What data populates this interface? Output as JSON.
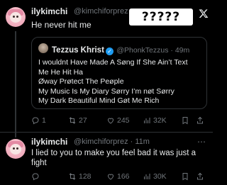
{
  "tweet1": {
    "name": "ilykimchi",
    "handle": "@kimchiforprez ·",
    "text": "He never hit me",
    "quote": {
      "name": "Tezzus Khrist",
      "handle": "@PhonkTezzus · 49m",
      "lines": [
        "I wouldnt Have Made A Søng If She Ain’t Text",
        "Me He Hit Ha",
        "Øway Prøtect The Peøple",
        "My Music Is My Diary Sørry I’m nøt Sørry",
        "My Dark Beautiful Mind Gøt Me Rich"
      ]
    },
    "metrics": {
      "replies": "1",
      "retweets": "27",
      "likes": "245",
      "views": "32K"
    }
  },
  "overlay_text": "?????",
  "tweet2": {
    "name": "ilykimchi",
    "handle": "@kimchiforprez · 11m",
    "text_line1": "I lied to you to make you feel bad it was just a",
    "text_line2": "fight",
    "metrics": {
      "retweets": "128",
      "likes": "166",
      "views": "30K"
    }
  },
  "icons": [
    "x-logo-icon",
    "more-options-icon",
    "reply-icon",
    "retweet-icon",
    "like-icon",
    "views-icon",
    "bookmark-icon",
    "share-icon",
    "verified-badge-icon"
  ],
  "colors": {
    "background": "#000000",
    "text": "#e7e9ea",
    "muted": "#71767b",
    "verified": "#1d9bf0",
    "border": "#2f3336"
  }
}
